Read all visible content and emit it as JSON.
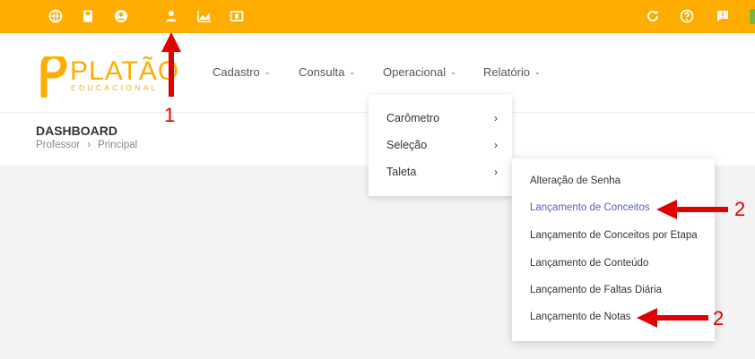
{
  "topbar": {
    "color": "#ffac00",
    "left_icons": [
      "globe-icon",
      "book-icon",
      "account-circle-icon",
      "person-icon",
      "chart-area-icon",
      "money-icon"
    ],
    "right_icons": [
      "refresh-icon",
      "help-icon",
      "feedback-icon"
    ]
  },
  "logo": {
    "word": "PLATÃO",
    "sub": "EDUCACIONAL"
  },
  "nav": {
    "items": [
      {
        "label": "Cadastro"
      },
      {
        "label": "Consulta"
      },
      {
        "label": "Operacional"
      },
      {
        "label": "Relatório"
      }
    ]
  },
  "page": {
    "title": "DASHBOARD",
    "breadcrumb": [
      "Professor",
      "Principal"
    ]
  },
  "operacional_menu": {
    "items": [
      {
        "label": "Carômetro"
      },
      {
        "label": "Seleção"
      },
      {
        "label": "Taleta"
      }
    ]
  },
  "taleta_submenu": {
    "items": [
      {
        "label": "Alteração de Senha"
      },
      {
        "label": "Lançamento de Conceitos",
        "active": true
      },
      {
        "label": "Lançamento de Conceitos por Etapa"
      },
      {
        "label": "Lançamento de Conteúdo"
      },
      {
        "label": "Lançamento de Faltas Diária"
      },
      {
        "label": "Lançamento de Notas"
      }
    ],
    "active_color": "#5560c8"
  },
  "annotations": {
    "label_1": "1",
    "label_2a": "2",
    "label_2b": "2",
    "color": "#e00000"
  }
}
